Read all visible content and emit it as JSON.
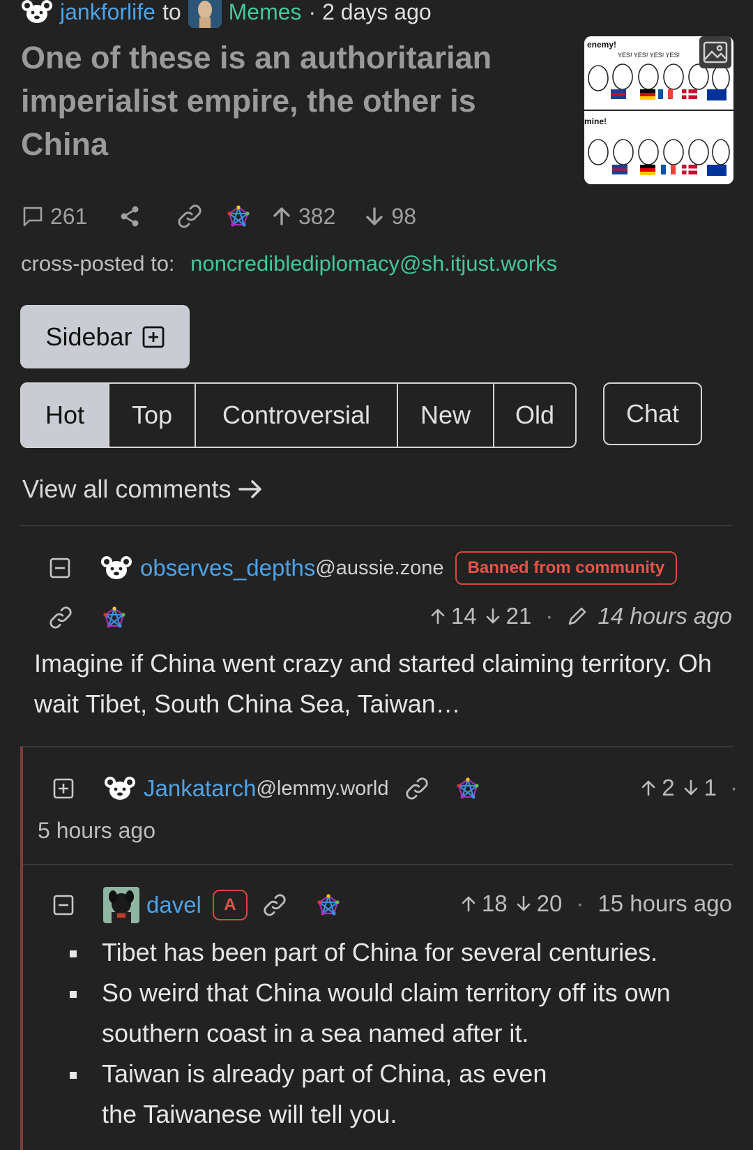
{
  "post": {
    "author": "jankforlife",
    "to_word": "to",
    "community": "Memes",
    "time": "· 2 days ago",
    "title": "One of these is an authoritarian imperialist empire, the other is China",
    "thumbnail_text": {
      "top": "enemy!",
      "yes": "YES! YES! YES! YES!",
      "bottom": "mine!"
    },
    "comments_count": "261",
    "upvotes": "382",
    "downvotes": "98",
    "crosspost_label": "cross-posted to:",
    "crosspost_target": "noncrediblediplomacy@sh.itjust.works"
  },
  "sidebar_button": "Sidebar",
  "sort_tabs": [
    "Hot",
    "Top",
    "Controversial",
    "New",
    "Old"
  ],
  "active_sort": "Hot",
  "chat_button": "Chat",
  "view_all": "View all comments",
  "comments": [
    {
      "user": "observes_depths",
      "instance": "@aussie.zone",
      "badge": "Banned from community",
      "up": "14",
      "down": "21",
      "time": "14 hours ago",
      "body": "Imagine if China went crazy and started claiming territory. Oh wait Tibet, South China Sea, Taiwan…"
    },
    {
      "user": "Jankatarch",
      "instance": "@lemmy.world",
      "up": "2",
      "down": "1",
      "time": "5 hours ago"
    },
    {
      "user": "davel",
      "badge": "A",
      "up": "18",
      "down": "20",
      "time": "15 hours ago",
      "bullets": [
        "Tibet has been part of China for several centuries.",
        "So weird that China would claim territory off its own southern coast in a sea named after it.",
        "Taiwan is already part of China, as even the Taiwanese will tell you."
      ]
    }
  ],
  "colors": {
    "background": "#222222",
    "link": "#4ea3e6",
    "community": "#43c79b",
    "banned": "#e5544a",
    "active_tab": "#c9cdd3"
  }
}
